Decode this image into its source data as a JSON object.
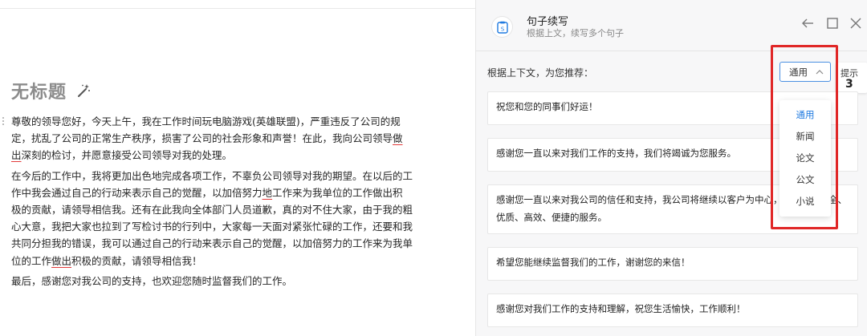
{
  "editor": {
    "title": "无标题",
    "paragraphs": [
      {
        "before": "尊敬的领导您好，今天上午，我在工作时间玩电脑游戏(英雄联盟)，严重违反了公司的规定，扰乱了公司的正常生产秩序，损害了公司的社会形象和声誉！在此，我向公司领导",
        "underline": "做出",
        "after": "深刻的检讨，并愿意接受公司领导对我的处理。"
      },
      {
        "before": "在今后的工作中，我将更加出色地完成各项工作，不辜负公司领导对我的期望。在以后的工作中我会通过自己的行动来表示自己的觉醒，以加倍努力",
        "underline": "地",
        "after": "工作来为我单位的工作做出积极的贡献，请领导相信我。还有在此我向全体部门人员道歉，真的对不住大家，由于我的粗心大意，我把大家也拉到了写检讨书的行列中，大家每一天面对紧张忙碌的工作，还要和我共同分担我的错误，我可以通过自己的行动来表示自己的觉醒，以加倍努力的工作来为我单位的工作",
        "underline2": "做出",
        "after2": "积极的贡献，请领导相信我！"
      },
      {
        "before": "最后，感谢您对我公司的支持，也欢迎您随时监督我们的工作。"
      }
    ]
  },
  "panel": {
    "title": "句子续写",
    "subtitle": "根据上文，续写多个句子",
    "recommend_label": "根据上下文，为您推荐：",
    "select_value": "通用",
    "hint_label": "提示",
    "hint_count": "3",
    "dropdown_options": [
      "通用",
      "新闻",
      "论文",
      "公文",
      "小说"
    ],
    "suggestions": [
      "祝您和您的同事们好运！",
      "感谢您一直以来对我们工作的支持，我们将竭诚为您服务。",
      "感谢您一直以来对我公司的信任和支持，我公司将继续以客户为中心，为您提供安全、优质、高效、便捷的服务。",
      "希望您能继续监督我们的工作，谢谢您的来信！",
      "感谢您对我们工作的支持和理解，祝您生活愉快，工作顺利！"
    ]
  },
  "colors": {
    "accent": "#1f7ae0",
    "highlight": "#e02727"
  }
}
